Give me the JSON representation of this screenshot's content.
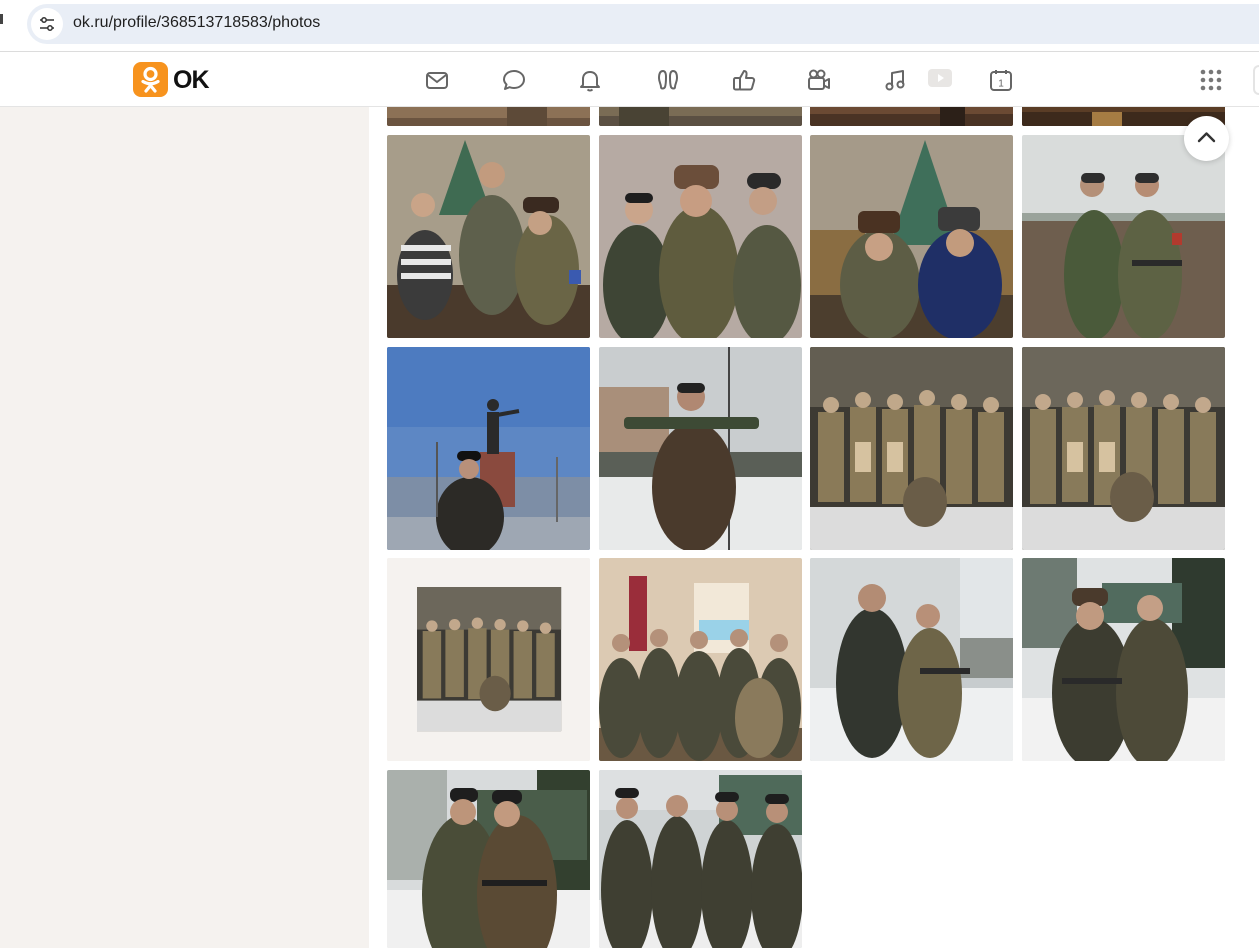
{
  "browser": {
    "url": "ok.ru/profile/368513718583/photos",
    "site_info_icon": "tune-icon"
  },
  "header": {
    "logo_text": "OK",
    "nav_icons": [
      "mail-icon",
      "chat-icon",
      "bell-icon",
      "guests-icon",
      "like-icon",
      "video-camera-icon",
      "music-icon",
      "play-icon",
      "calendar-icon"
    ],
    "calendar_day": "1",
    "apps_icon": "grid-icon"
  },
  "photos": {
    "grid": [
      {
        "id": "row0",
        "items": 4,
        "partial": true
      },
      {
        "id": "row1",
        "items": 4
      },
      {
        "id": "row2",
        "items": 4
      },
      {
        "id": "row3",
        "items": 4
      },
      {
        "id": "row4",
        "items": 2
      }
    ],
    "scroll_to_top_icon": "chevron-up-icon"
  },
  "colors": {
    "brand_orange": "#f7931e",
    "background": "#f5f2ef",
    "address_bar": "#e9eef6"
  }
}
